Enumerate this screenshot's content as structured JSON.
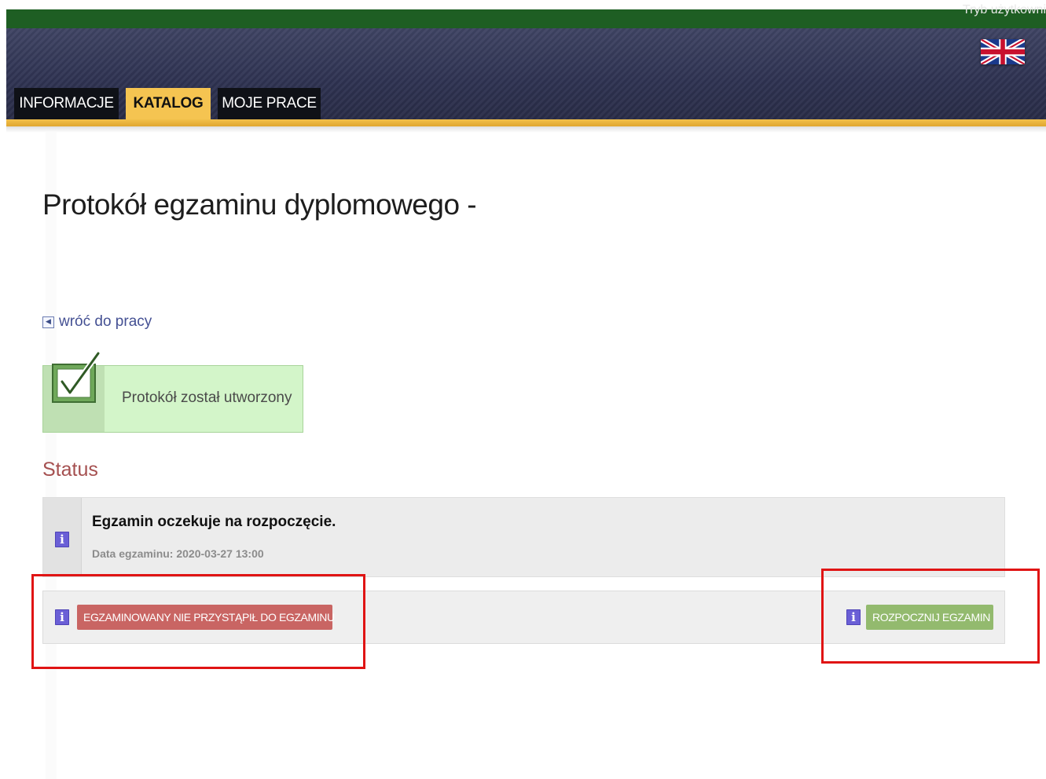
{
  "header": {
    "mode_text": "Tryb użytkowni",
    "language_flag": "uk-flag-icon"
  },
  "tabs": [
    {
      "label": "INFORMACJE",
      "active": false
    },
    {
      "label": "KATALOG",
      "active": true
    },
    {
      "label": "MOJE PRACE",
      "active": false
    }
  ],
  "page": {
    "title": "Protokół egzaminu dyplomowego -",
    "back_link": "wróć do pracy"
  },
  "success_message": {
    "text": "Protokół został utworzony",
    "icon": "checkmark-icon"
  },
  "status": {
    "heading": "Status",
    "title": "Egzamin oczekuje na rozpoczęcie.",
    "date_label": "Data egzaminu: 2020-03-27 13:00",
    "icon": "info-icon"
  },
  "actions": {
    "absent_button": "EGZAMINOWANY NIE PRZYSTĄPIŁ DO EGZAMINU",
    "start_button": "ROZPOCZNIJ EGZAMIN",
    "info_glyph": "i"
  },
  "colors": {
    "top_bar": "#1e5e23",
    "header": "#2e3251",
    "accent_gold": "#f5c451",
    "absent_button": "#c96563",
    "start_button": "#93ba6e",
    "highlight": "#e01414",
    "info_icon": "#6a5fd6"
  }
}
